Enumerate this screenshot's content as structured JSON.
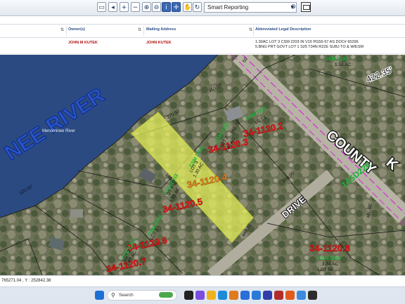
{
  "toolbar": {
    "report_select": "Smart Reporting"
  },
  "table": {
    "columns": [
      "Owner(s)",
      "Mailing Address",
      "Abbreviated Legal Description"
    ],
    "rows": [
      {
        "owner": "JOHN M KUTEK",
        "mailing": "JOHN KUTEK",
        "legal_line1": "1.30AC LOT 3 CSM 2203 IN V15 PG56-57 AS DOC# 65296",
        "legal_line2": "5.BNG PRT GOVT LOT 1 S25 T34N R22E SUBJ TO & W/ESM"
      }
    ]
  },
  "map": {
    "river_label": "NEE RIVER",
    "river_small_label": "Menominee River",
    "road_county": "COUNTY",
    "road_county2": "K",
    "road_drive": "DRIVE",
    "parcels": [
      {
        "id": "34-1120.2",
        "csm": "CSM 2291",
        "lot": "LOT 1"
      },
      {
        "id": "34-1120.3",
        "csm": "CSM 2203",
        "lot": "LOT 2",
        "ac": "1.45 AC"
      },
      {
        "id": "34-1120.4",
        "csm": "CSM 2203",
        "lot": "LOT 3",
        "ac": "1.30 AC"
      },
      {
        "id": "34-1120.5",
        "csm": "CSM 2203",
        "lot": "LOT 4",
        "ac": "1.43 AC"
      },
      {
        "id": "34-1120.6",
        "csm": "CSM 2204",
        "lot": "LOT 1"
      },
      {
        "id": "34-1120.7",
        "csm": "CSM 2204",
        "lot": "LOT 2",
        "ac": "1.43 AC"
      },
      {
        "id": "34-1120.8",
        "csm": "CSM 2545",
        "lot": "LOT 55",
        "ac": "3.84 AC"
      }
    ],
    "small_labels": {
      "csm_top": "CSM 2103",
      "ac_top": "1.53 AC",
      "dist_top": "422.35'",
      "num_hwy": "14SD226",
      "dim_480": "480.00'",
      "dim_350": "350.00'",
      "dim_165": "165.00'",
      "dim_449": "449.76'",
      "dim_155": "155.05'",
      "dim_398": "398.02'",
      "dim_270": "270.93'",
      "dim_120": "120.00'",
      "dim_50": "50'"
    }
  },
  "status": {
    "coords": "765271.04 , Y : 252842.38"
  },
  "taskbar": {
    "search": "Search"
  },
  "colors": {
    "parcel_red": "#ee1c1c",
    "csm_green": "#19b13a",
    "highlight": "#e8f25a",
    "river_blue": "#2a55c8"
  }
}
